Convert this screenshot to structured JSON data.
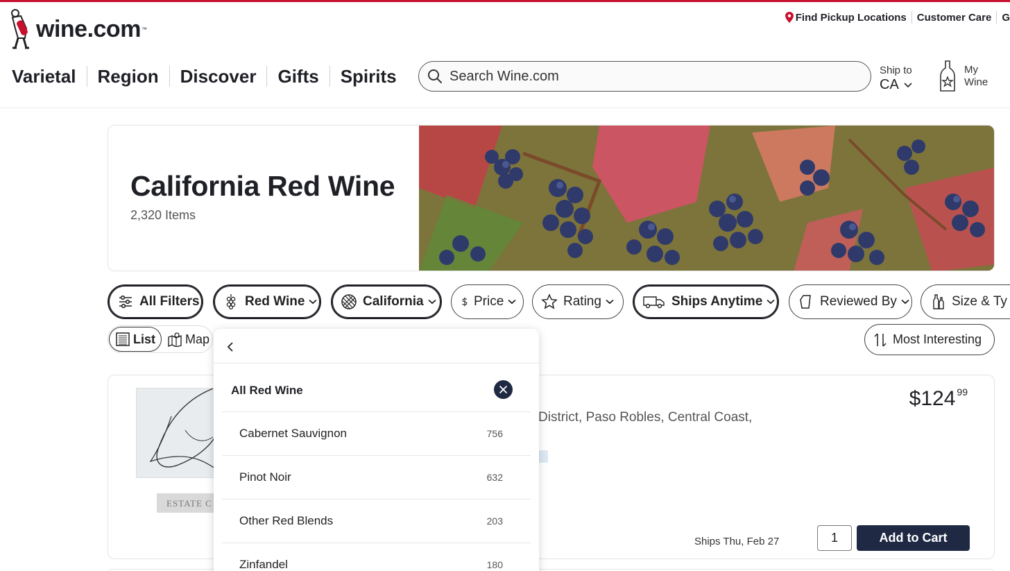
{
  "brand": {
    "name": "wine.com",
    "tm": "™",
    "accent": "#c8102e",
    "dark": "#1f2944"
  },
  "utility": {
    "pickup": "Find Pickup Locations",
    "care": "Customer Care",
    "cutoff": "G"
  },
  "nav": [
    "Varietal",
    "Region",
    "Discover",
    "Gifts",
    "Spirits"
  ],
  "search": {
    "placeholder": "Search Wine.com"
  },
  "ship_to": {
    "label": "Ship to",
    "value": "CA"
  },
  "my_wine": {
    "label": "My Wine"
  },
  "hero": {
    "title": "California Red Wine",
    "count": "2,320 Items"
  },
  "filters": {
    "all": "All Filters",
    "red": "Red Wine",
    "california": "California",
    "price": "Price",
    "rating": "Rating",
    "ships": "Ships Anytime",
    "reviewed": "Reviewed By",
    "size": "Size & Ty"
  },
  "view": {
    "list": "List",
    "map": "Map"
  },
  "sort": {
    "label": "Most Interesting"
  },
  "product": {
    "region": "District, Paso Robles, Central Coast,",
    "price_main": "$124",
    "price_cents": "99",
    "label_strip": "ESTATE C",
    "ships": "Ships Thu, Feb 27",
    "qty": "1",
    "add": "Add to Cart"
  },
  "dropdown": {
    "all_label": "All Red Wine",
    "items": [
      {
        "name": "Cabernet Sauvignon",
        "count": "756"
      },
      {
        "name": "Pinot Noir",
        "count": "632"
      },
      {
        "name": "Other Red Blends",
        "count": "203"
      },
      {
        "name": "Zinfandel",
        "count": "180"
      }
    ]
  }
}
